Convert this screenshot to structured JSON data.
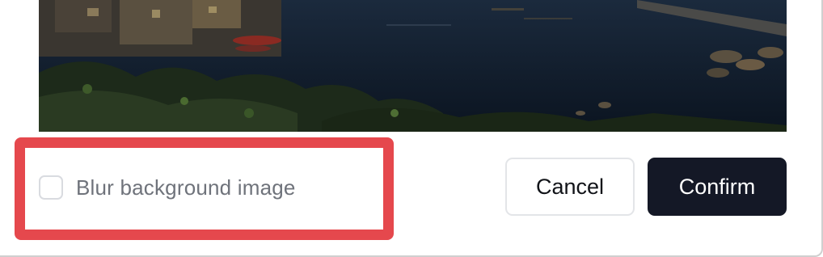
{
  "dialog": {
    "preview_image": "image-preview",
    "blur_option": {
      "label": "Blur background image",
      "checked": false
    },
    "buttons": {
      "cancel_label": "Cancel",
      "confirm_label": "Confirm"
    },
    "colors": {
      "highlight": "#e5484d",
      "confirm_bg": "#141826",
      "label_text": "#6f737b"
    }
  }
}
